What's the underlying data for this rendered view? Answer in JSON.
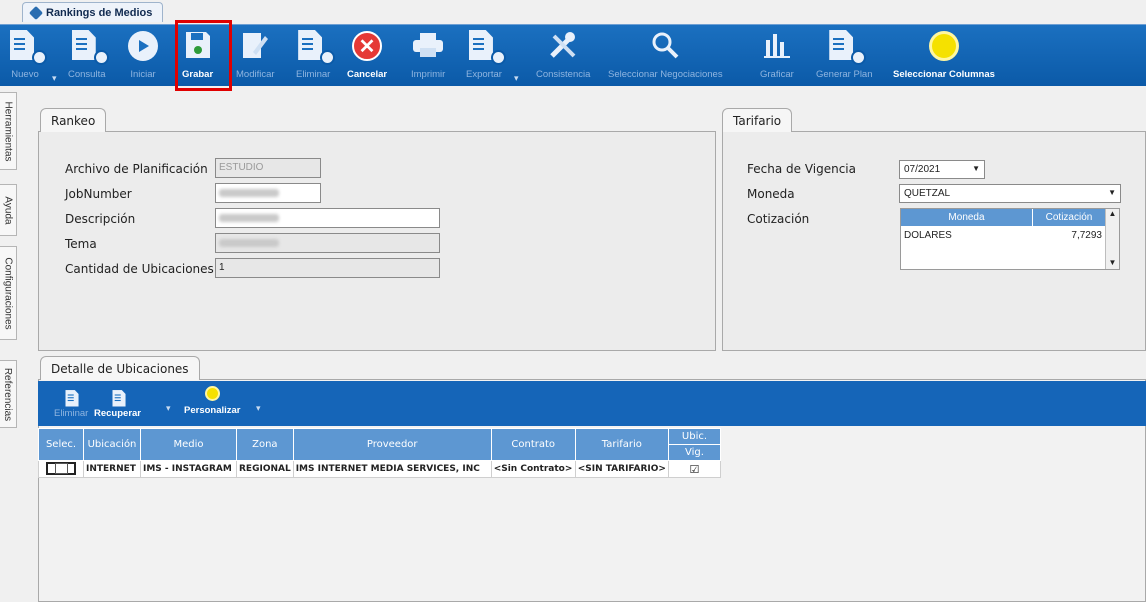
{
  "app_tab": {
    "title": "Rankings de Medios"
  },
  "toolbar": {
    "nuevo": "Nuevo",
    "consulta": "Consulta",
    "iniciar": "Iniciar",
    "grabar": "Grabar",
    "modificar": "Modificar",
    "eliminar": "Eliminar",
    "cancelar": "Cancelar",
    "imprimir": "Imprimir",
    "exportar": "Exportar",
    "consistencia": "Consistencia",
    "seleccionar_negociaciones": "Seleccionar Negociaciones",
    "graficar": "Graficar",
    "generar_plan": "Generar Plan",
    "seleccionar_columnas": "Seleccionar Columnas"
  },
  "side_tabs": [
    "Herramientas",
    "Ayuda",
    "Configuraciones",
    "Referencias"
  ],
  "rankeo": {
    "tab": "Rankeo",
    "archivo_label": "Archivo de Planificación",
    "archivo_value": "ESTUDIO",
    "jobnumber_label": "JobNumber",
    "descripcion_label": "Descripción",
    "tema_label": "Tema",
    "cantidad_label": "Cantidad de Ubicaciones",
    "cantidad_value": "1"
  },
  "tarifario": {
    "tab": "Tarifario",
    "fecha_label": "Fecha de Vigencia",
    "fecha_value": "07/2021",
    "moneda_label": "Moneda",
    "moneda_value": "QUETZAL",
    "cotizacion_label": "Cotización",
    "table_headers": {
      "moneda": "Moneda",
      "cotizacion": "Cotización"
    },
    "rows": [
      {
        "moneda": "DOLARES",
        "cotizacion": "7,7293"
      }
    ]
  },
  "detalle": {
    "tab": "Detalle de Ubicaciones",
    "toolbar": {
      "eliminar": "Eliminar",
      "recuperar": "Recuperar",
      "personalizar": "Personalizar"
    },
    "headers": {
      "selec": "Selec.",
      "ubicacion": "Ubicación",
      "medio": "Medio",
      "zona": "Zona",
      "proveedor": "Proveedor",
      "contrato": "Contrato",
      "tarifario": "Tarifario",
      "ubic": "Ubic.",
      "vig": "Vig."
    },
    "rows": [
      {
        "ubicacion": "INTERNET",
        "medio": "IMS - INSTAGRAM",
        "zona": "REGIONAL",
        "proveedor": "IMS INTERNET MEDIA SERVICES, INC",
        "contrato": "<Sin Contrato>",
        "tarifario": "<SIN TARIFARIO>",
        "vig_checked": true
      }
    ]
  },
  "colors": {
    "toolbar": "#0b5aa8",
    "grid_header": "#5d97d2",
    "highlight": "#e00000"
  }
}
